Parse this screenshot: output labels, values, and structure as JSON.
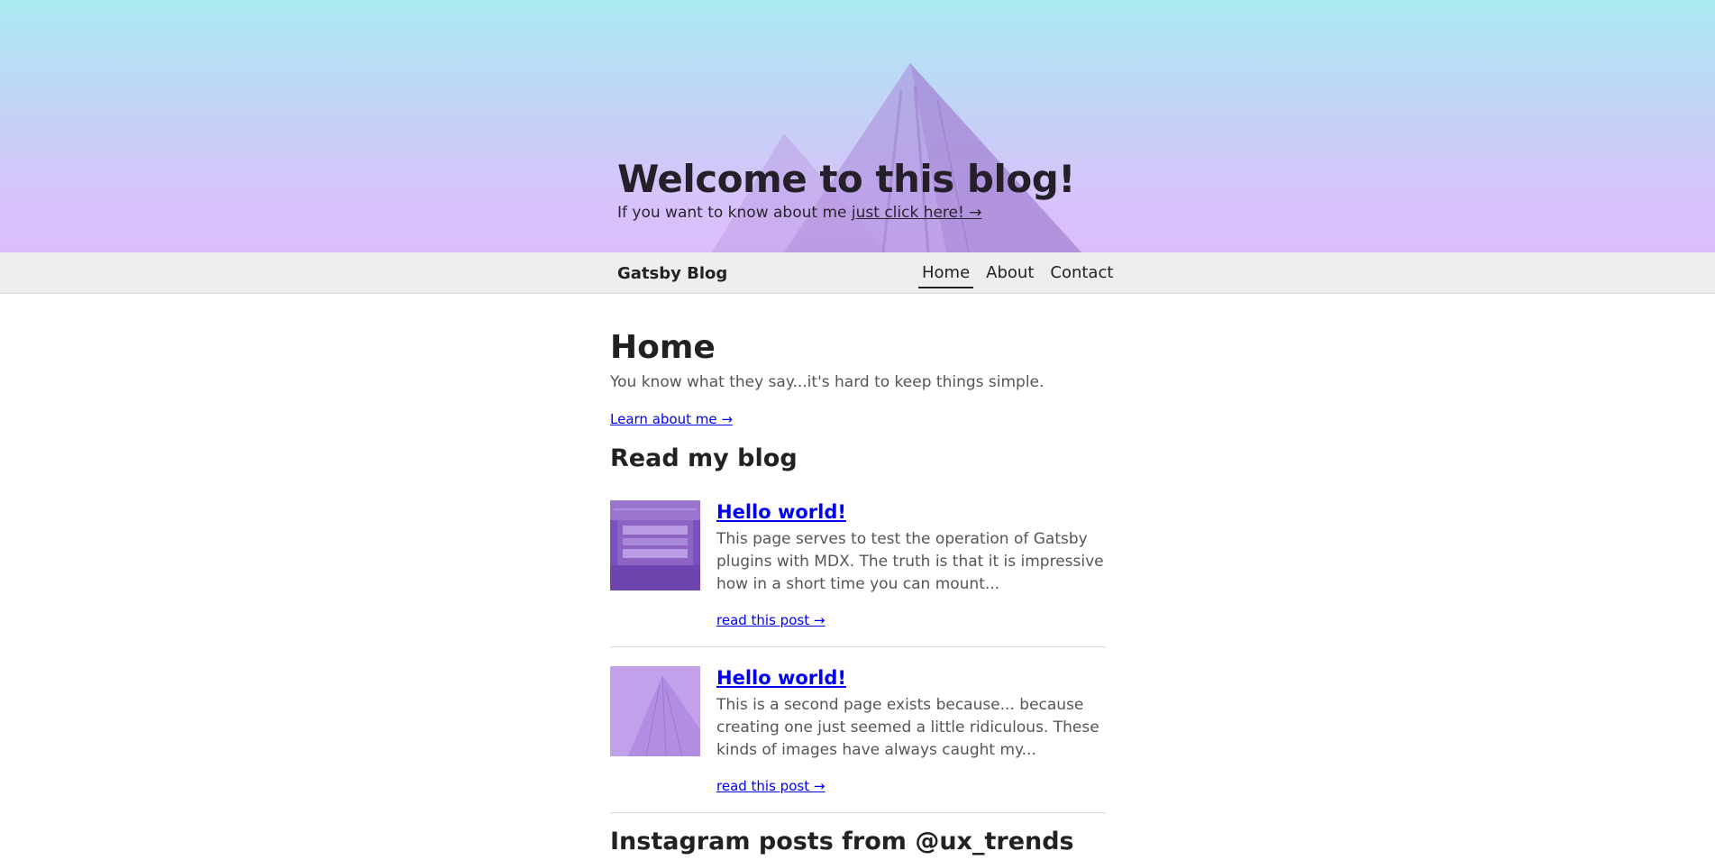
{
  "hero": {
    "title": "Welcome to this blog!",
    "subtitle_prefix": "If you want to know about me ",
    "subtitle_link": "just click here! →"
  },
  "nav": {
    "brand": "Gatsby Blog",
    "links": [
      {
        "label": "Home",
        "active": true
      },
      {
        "label": "About",
        "active": false
      },
      {
        "label": "Contact",
        "active": false
      }
    ]
  },
  "main": {
    "title": "Home",
    "intro": "You know what they say...it's hard to keep things simple.",
    "learn_link": "Learn about me →",
    "blog_heading": "Read my blog",
    "posts": [
      {
        "title": "Hello world!",
        "excerpt": "This page serves to test the operation of Gatsby plugins with MDX. The truth is that it is impressive how in a short time you can mount...",
        "read_more": "read this post →"
      },
      {
        "title": "Hello world!",
        "excerpt": "This is a second page exists because... because creating one just seemed a little ridiculous. These kinds of images have always caught my...",
        "read_more": "read this post →"
      }
    ],
    "instagram_heading": "Instagram posts from @ux_trends"
  },
  "colors": {
    "link": "#0000ee",
    "nav_background": "#eeeeee",
    "hero_top": "#aaeaf2",
    "hero_bottom": "#dabefc"
  }
}
